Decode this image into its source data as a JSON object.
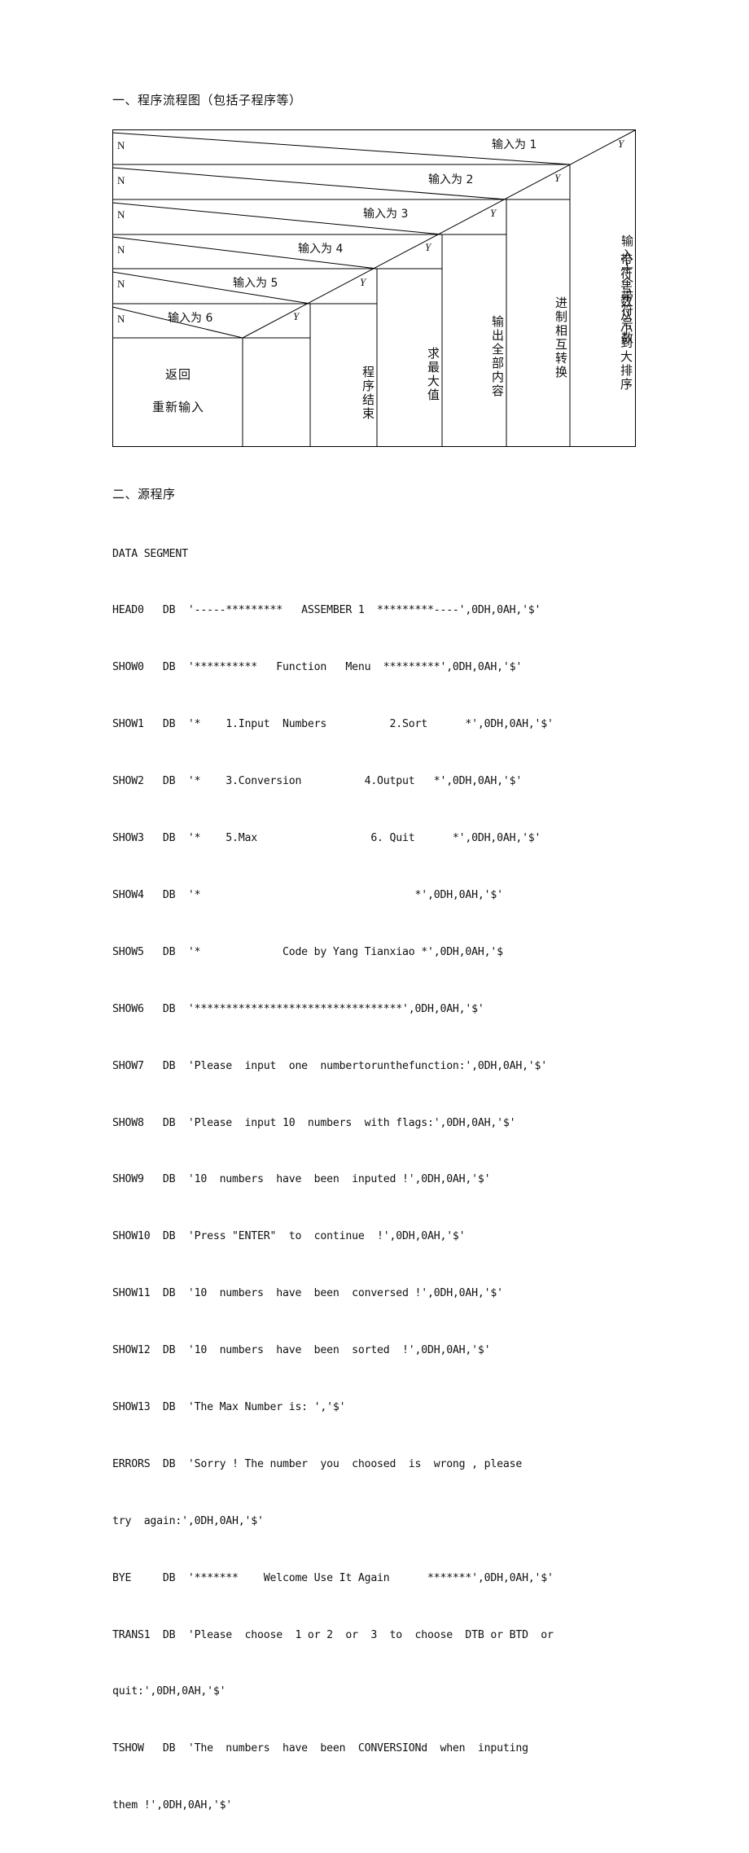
{
  "document": {
    "section1_heading": "一、程序流程图（包括子程序等）",
    "section2_heading": "二、源程序"
  },
  "flowchart": {
    "no_labels": [
      "N",
      "N",
      "N",
      "N",
      "N",
      "N"
    ],
    "yes_labels": [
      "Y",
      "Y",
      "Y",
      "Y",
      "Y",
      "Y"
    ],
    "conditions": [
      "输入为 1",
      "输入为 2",
      "输入为 3",
      "输入为 4",
      "输入为 5",
      "输入为 6"
    ],
    "actions": {
      "col1_line1": "返回",
      "col1_line2": "重新输入",
      "col2": "程序结束",
      "col3": "求最大值",
      "col4": "输出全部内容",
      "col5": "进制相互转换",
      "col6": "带符号数从小到大排序",
      "col7": "输入十个带符号数"
    }
  },
  "source_code": {
    "lines": [
      "DATA SEGMENT",
      "HEAD0   DB  '-----*********   ASSEMBER 1  *********----',0DH,0AH,'$'",
      "SHOW0   DB  '**********   Function   Menu  *********',0DH,0AH,'$'",
      "SHOW1   DB  '*    1.Input  Numbers          2.Sort      *',0DH,0AH,'$'",
      "SHOW2   DB  '*    3.Conversion          4.Output   *',0DH,0AH,'$'",
      "SHOW3   DB  '*    5.Max                  6. Quit      *',0DH,0AH,'$'",
      "SHOW4   DB  '*                                  *',0DH,0AH,'$'",
      "SHOW5   DB  '*             Code by Yang Tianxiao *',0DH,0AH,'$",
      "SHOW6   DB  '*********************************',0DH,0AH,'$'",
      "SHOW7   DB  'Please  input  one  numbertorunthefunction:',0DH,0AH,'$'",
      "SHOW8   DB  'Please  input 10  numbers  with flags:',0DH,0AH,'$'",
      "SHOW9   DB  '10  numbers  have  been  inputed !',0DH,0AH,'$'",
      "SHOW10  DB  'Press \"ENTER\"  to  continue  !',0DH,0AH,'$'",
      "SHOW11  DB  '10  numbers  have  been  conversed !',0DH,0AH,'$'",
      "SHOW12  DB  '10  numbers  have  been  sorted  !',0DH,0AH,'$'",
      "SHOW13  DB  'The Max Number is: ','$'",
      "ERRORS  DB  'Sorry ! The number  you  choosed  is  wrong , please",
      "try  again:',0DH,0AH,'$'",
      "BYE     DB  '*******    Welcome Use It Again      *******',0DH,0AH,'$'",
      "TRANS1  DB  'Please  choose  1 or 2  or  3  to  choose  DTB or BTD  or",
      "quit:',0DH,0AH,'$'",
      "TSHOW   DB  'The  numbers  have  been  CONVERSIONd  when  inputing",
      "them !',0DH,0AH,'$'"
    ]
  },
  "colors": {
    "ink": "#111111",
    "line": "#000000",
    "paper": "#ffffff"
  }
}
